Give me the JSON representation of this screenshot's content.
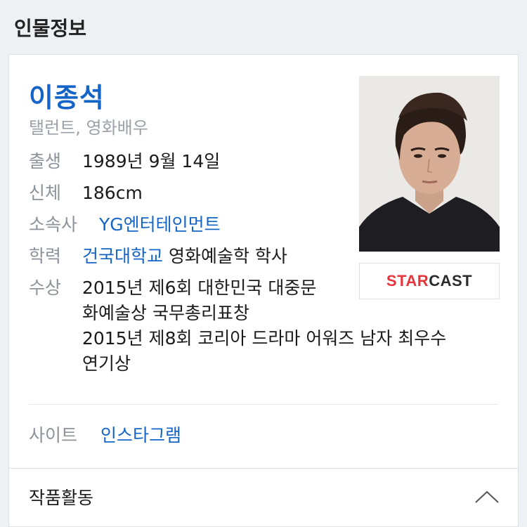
{
  "section": {
    "title": "인물정보"
  },
  "person": {
    "name": "이종석",
    "occupation": "탤런트, 영화배우",
    "birth": {
      "label": "출생",
      "value": "1989년 9월 14일"
    },
    "body": {
      "label": "신체",
      "value": "186cm"
    },
    "agency": {
      "label": "소속사",
      "value": "YG엔터테인먼트"
    },
    "education": {
      "label": "학력",
      "school": "건국대학교",
      "detail": "영화예술학 학사"
    },
    "awards": {
      "label": "수상",
      "lines": [
        "2015년 제6회 대한민국 대중문",
        "화예술상 국무총리표창",
        "2015년 제8회 코리아 드라마 어워즈 남자 최우수",
        "연기상"
      ]
    },
    "site": {
      "label": "사이트",
      "value": "인스타그램"
    }
  },
  "starcast": {
    "part1": "STAR",
    "part2": "CAST"
  },
  "works": {
    "title": "작품활동",
    "chevron_icon": "chevron-up-icon"
  },
  "colors": {
    "link": "#1565c8",
    "label": "#8c939a",
    "starcast_red": "#e8353b",
    "background": "#eef0f3"
  }
}
